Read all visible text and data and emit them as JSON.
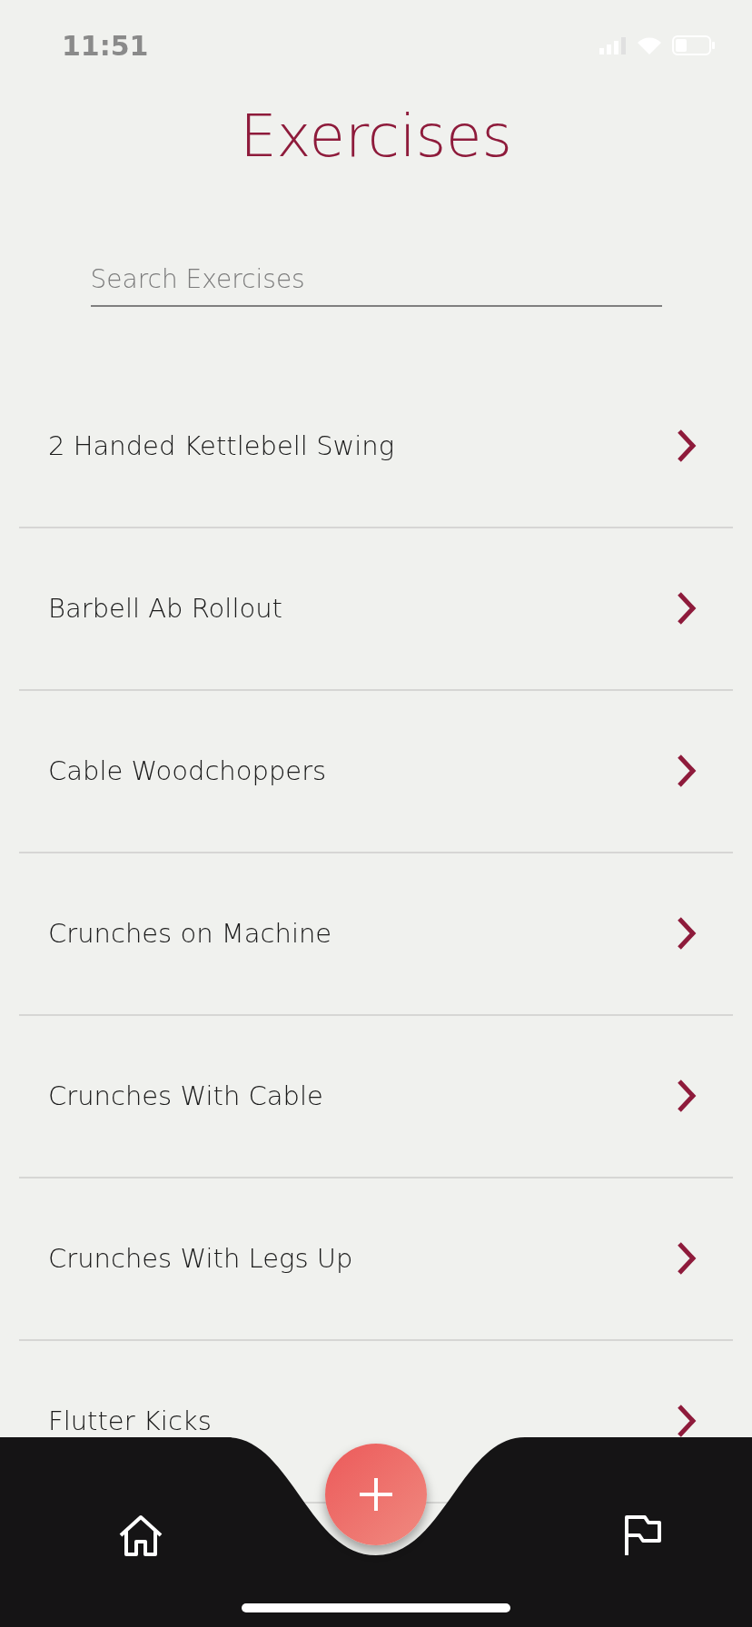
{
  "status_bar": {
    "time": "11:51"
  },
  "title": "Exercises",
  "search": {
    "placeholder": "Search Exercises"
  },
  "exercises": [
    {
      "name": "2 Handed Kettlebell Swing"
    },
    {
      "name": "Barbell Ab Rollout"
    },
    {
      "name": "Cable Woodchoppers"
    },
    {
      "name": "Crunches on Machine"
    },
    {
      "name": "Crunches With Cable"
    },
    {
      "name": "Crunches With Legs Up"
    },
    {
      "name": "Flutter Kicks"
    }
  ]
}
